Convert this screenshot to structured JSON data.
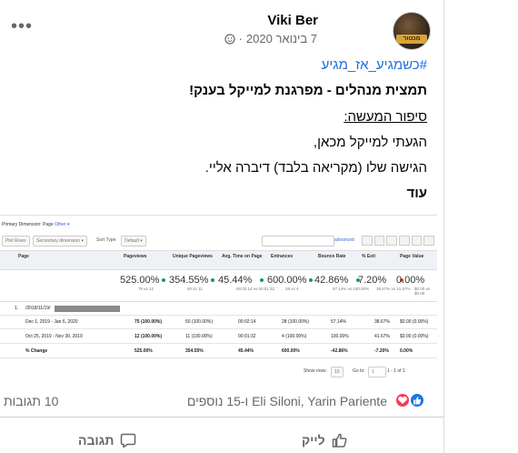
{
  "post": {
    "author": "Viki Ber",
    "date": "7 בינואר 2020",
    "separator": "·",
    "hashtag": "#כשמגיע_אז_מגיע",
    "lines": [
      "תמצית מנהלים - מפרגנת למייקל בענק!",
      "סיפור המעשה:",
      "הגעתי למייקל מכאן,",
      "הגישה שלו (מקריאה בלבד) דיברה אליי.",
      "עוד"
    ],
    "more_menu": "•••",
    "avatar_logo": "מנטור"
  },
  "analytics": {
    "primary_dimension_label": "Primary Dimension: Page",
    "primary_dimension_other": "Other ▾",
    "controls": [
      "Plot Rows",
      "Secondary dimension ▾",
      "Sort Type:",
      "Default ▾",
      "advanced"
    ],
    "columns": [
      "Page",
      "Pageviews",
      "Unique Pageviews",
      "Avg. Time on Page",
      "Entrances",
      "Bounce Rate",
      "% Exit",
      "Page Value"
    ],
    "totals": [
      {
        "big": "525.00%",
        "sub": "75 vs 12",
        "dot": "#0f9d58"
      },
      {
        "big": "354.55%",
        "sub": "50 vs 11",
        "dot": "#0f9d58"
      },
      {
        "big": "45.44%",
        "sub": "00:02:14 vs 00:01:32",
        "dot": "#0f9d58"
      },
      {
        "big": "600.00%",
        "sub": "28 vs 4",
        "dot": "#0f9d58"
      },
      {
        "big": "42.86%",
        "sub": "57.14% vs 100.00%",
        "dot": "#0f9d58"
      },
      {
        "big": "7.20%",
        "sub": "38.67% vs 41.67%",
        "dot": "#db4437"
      },
      {
        "big": "0.00%",
        "sub": "$0.00 vs $0.00",
        "dot": ""
      }
    ],
    "row_index": "1.",
    "row_page": "/2018/11/19/",
    "rows": [
      {
        "label": "Dec 1, 2019 - Jan 6, 2020",
        "c1": "75 (100.00%)",
        "c2": "50 (100.00%)",
        "c3": "00:02:14",
        "c4": "28 (100.00%)",
        "c5": "57.14%",
        "c6": "38.67%",
        "c7": "$0.00 (0.00%)"
      },
      {
        "label": "Oct 25, 2019 - Nov 30, 2019",
        "c1": "12 (100.00%)",
        "c2": "11 (100.00%)",
        "c3": "00:01:32",
        "c4": "4 (100.00%)",
        "c5": "100.00%",
        "c6": "41.67%",
        "c7": "$0.00 (0.00%)"
      },
      {
        "label": "% Change",
        "c1": "525.00%",
        "c2": "354.55%",
        "c3": "45.44%",
        "c4": "600.00%",
        "c5": "-42.86%",
        "c6": "-7.20%",
        "c7": "0.00%"
      }
    ],
    "show_rows_label": "Show rows:",
    "show_rows_value": "10",
    "goto_label": "Go to:",
    "goto_value": "1",
    "pagination": "1 - 1 of 1"
  },
  "reactions": {
    "names": "Eli Siloni, Yarin Pariente ו-15 נוספים",
    "comments": "10 תגובות"
  },
  "actions": {
    "like": "לייק",
    "comment": "תגובה"
  },
  "colors": {
    "link": "#216fdb",
    "muted": "#65676b",
    "like_blue": "#1b74e4",
    "love_red": "#f33e58"
  }
}
